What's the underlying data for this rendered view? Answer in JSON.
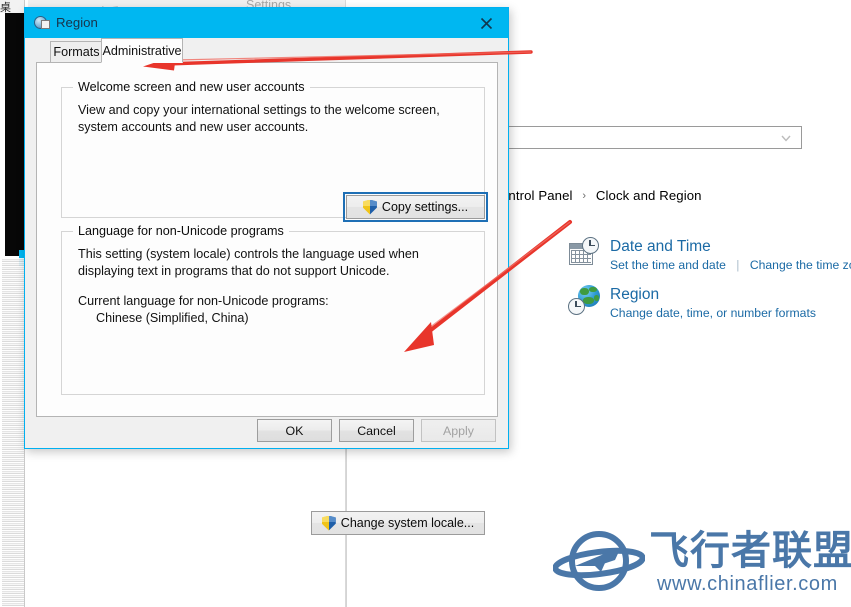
{
  "background": {
    "left_strip_cjk": "桌",
    "ghost_window_title": "Settings",
    "back_arrow_icon": "back-arrow-icon"
  },
  "control_panel": {
    "search_placeholder": "",
    "search_value": "",
    "search_chevron_icon": "chevron-down-icon",
    "breadcrumb": {
      "root": "ontrol Panel",
      "separator": "›",
      "current": "Clock and Region"
    },
    "items": [
      {
        "icon": "calendar-clock-icon",
        "title": "Date and Time",
        "links": [
          "Set the time and date",
          "Change the time zor"
        ],
        "link_divider": "|"
      },
      {
        "icon": "globe-clock-icon",
        "title": "Region",
        "links": [
          "Change date, time, or number formats"
        ],
        "link_divider": ""
      }
    ]
  },
  "dialog": {
    "title": "Region",
    "title_icon": "region-globe-flag-icon",
    "close_icon": "close-icon",
    "tabs": [
      {
        "label": "Formats",
        "selected": false
      },
      {
        "label": "Administrative",
        "selected": true
      }
    ],
    "groups": [
      {
        "legend": "Welcome screen and new user accounts",
        "paragraphs": [
          "View and copy your international settings to the welcome screen, system accounts and new user accounts."
        ],
        "button": {
          "label": "Copy settings...",
          "icon": "uac-shield-icon",
          "focused": true
        }
      },
      {
        "legend": "Language for non-Unicode programs",
        "paragraphs": [
          "This setting (system locale) controls the language used when displaying text in programs that do not support Unicode.",
          "Current language for non-Unicode programs:"
        ],
        "current_language": "Chinese (Simplified, China)",
        "button": {
          "label": "Change system locale...",
          "icon": "uac-shield-icon",
          "focused": false
        }
      }
    ],
    "footer_buttons": [
      {
        "label": "OK",
        "enabled": true
      },
      {
        "label": "Cancel",
        "enabled": true
      },
      {
        "label": "Apply",
        "enabled": false
      }
    ]
  },
  "annotations": {
    "arrow_color": "#e8352b",
    "arrows": [
      {
        "name": "arrow-to-administrative-tab",
        "target": "Administrative tab"
      },
      {
        "name": "arrow-to-change-system-locale",
        "target": "Change system locale... button"
      }
    ]
  },
  "watermark": {
    "logo_icon": "airplane-orbit-logo-icon",
    "brand_cjk": "飞行者联盟",
    "url": "www.chinaflier.com",
    "color": "#4a77a8"
  }
}
